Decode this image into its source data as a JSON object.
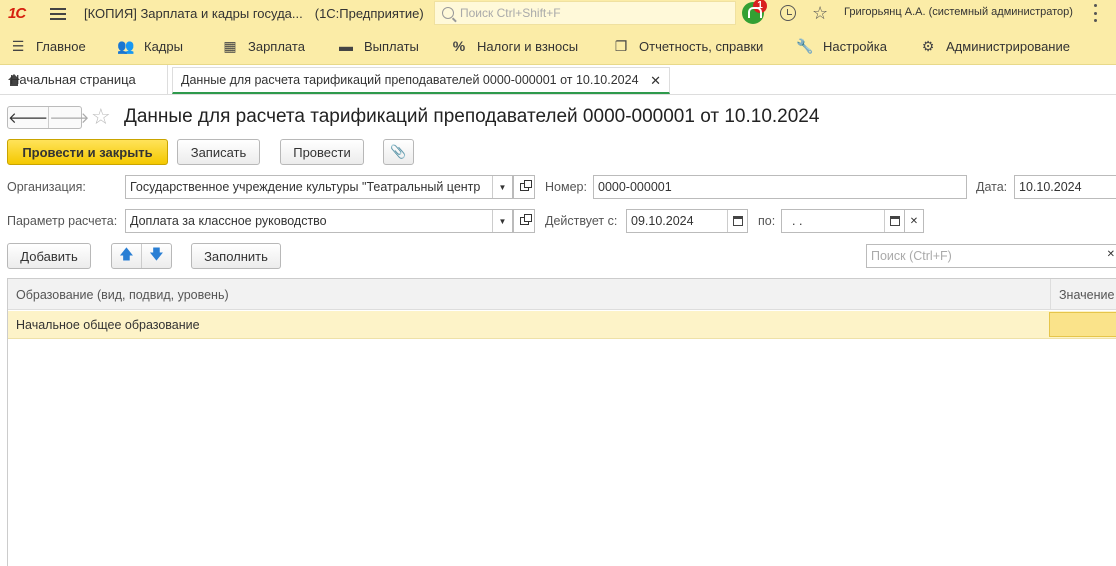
{
  "titlebar": {
    "logo": "1С",
    "app_title": "[КОПИЯ] Зарплата и кадры госуда...",
    "app_sub": "(1С:Предприятие)",
    "search_placeholder": "Поиск Ctrl+Shift+F",
    "notifications_count": "1",
    "user": "Григорьянц А.А. (системный администратор)"
  },
  "sections": [
    {
      "label": "Главное",
      "icon": "menu-icon"
    },
    {
      "label": "Кадры",
      "icon": "people-icon"
    },
    {
      "label": "Зарплата",
      "icon": "calculator-icon"
    },
    {
      "label": "Выплаты",
      "icon": "wallet-icon"
    },
    {
      "label": "Налоги и взносы",
      "icon": "percent-icon"
    },
    {
      "label": "Отчетность, справки",
      "icon": "documents-icon"
    },
    {
      "label": "Настройка",
      "icon": "wrench-icon"
    },
    {
      "label": "Администрирование",
      "icon": "gear-icon"
    }
  ],
  "tabs": {
    "home": "Начальная страница",
    "active": "Данные для расчета тарификаций преподавателей 0000-000001 от 10.10.2024"
  },
  "form": {
    "title": "Данные для расчета тарификаций преподавателей 0000-000001 от 10.10.2024",
    "buttons": {
      "post_close": "Провести и закрыть",
      "save": "Записать",
      "post": "Провести"
    },
    "organization_label": "Организация:",
    "organization_value": "Государственное учреждение культуры \"Театральный центр",
    "number_label": "Номер:",
    "number_value": "0000-000001",
    "date_label": "Дата:",
    "date_value": "10.10.2024",
    "param_label": "Параметр расчета:",
    "param_value": "Доплата за классное руководство",
    "valid_from_label": "Действует с:",
    "valid_from_value": "09.10.2024",
    "valid_to_label": "по:",
    "valid_to_value": " .  ."
  },
  "toolbar": {
    "add": "Добавить",
    "fill": "Заполнить",
    "search_placeholder": "Поиск (Ctrl+F)"
  },
  "table": {
    "columns": [
      "Образование (вид, подвид, уровень)",
      "Значение"
    ],
    "rows": [
      {
        "education": "Начальное общее образование",
        "value": ""
      }
    ]
  }
}
